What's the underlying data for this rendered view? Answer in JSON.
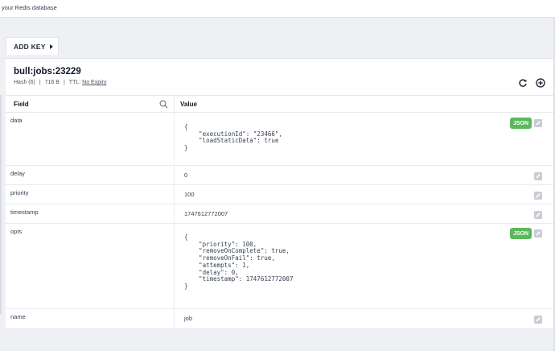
{
  "topbar": {
    "text": "your Redis database"
  },
  "toolbar": {
    "add_key_label": "ADD KEY"
  },
  "key": {
    "name": "bull:jobs:23229",
    "type": "Hash (6)",
    "size": "716 B",
    "ttl_label": "TTL:",
    "ttl_value": "No Expiry"
  },
  "table": {
    "header_field": "Field",
    "header_value": "Value",
    "badge_label": "JSON",
    "rows": [
      {
        "field": "data",
        "value": "{\n    \"executionId\": \"23466\",\n    \"loadStaticData\": true\n}"
      },
      {
        "field": "delay",
        "value": "0"
      },
      {
        "field": "priority",
        "value": "100"
      },
      {
        "field": "timestamp",
        "value": "1747612772007"
      },
      {
        "field": "opts",
        "value": "{\n    \"priority\": 100,\n    \"removeOnComplete\": true,\n    \"removeOnFail\": true,\n    \"attempts\": 1,\n    \"delay\": 0,\n    \"timestamp\": 1747612772007\n}"
      },
      {
        "field": "name",
        "value": "job"
      }
    ]
  },
  "colors": {
    "json_badge": "#5cb85c",
    "edit_icon": "#c9cdd3",
    "background": "#eef0f4"
  },
  "icons": [
    "caret-right-icon",
    "refresh-icon",
    "add-circle-icon",
    "search-icon",
    "edit-icon"
  ]
}
